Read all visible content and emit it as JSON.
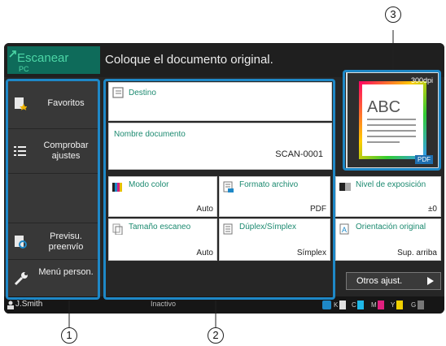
{
  "app": {
    "title": "Escanear",
    "subtitle": "PC"
  },
  "header": {
    "message": "Coloque el documento original."
  },
  "sidebar": {
    "items": [
      {
        "label": "Favoritos",
        "icon": "favorites-icon"
      },
      {
        "label": "Comprobar ajustes",
        "icon": "list-icon"
      },
      {
        "label": "Previsu. preenvío",
        "icon": "preview-icon"
      },
      {
        "label": "Menú person.",
        "icon": "wrench-icon"
      }
    ]
  },
  "fields": {
    "destino": {
      "label": "Destino",
      "value": ""
    },
    "nombre": {
      "label": "Nombre documento",
      "value": "SCAN-0001"
    }
  },
  "settings": [
    {
      "label": "Modo color",
      "value": "Auto"
    },
    {
      "label": "Formato archivo",
      "value": "PDF"
    },
    {
      "label": "Nivel de exposición",
      "value": "±0"
    },
    {
      "label": "Tamaño escaneo",
      "value": "Auto"
    },
    {
      "label": "Dúplex/Símplex",
      "value": "Símplex"
    },
    {
      "label": "Orientación original",
      "value": "Sup. arriba"
    }
  ],
  "preview": {
    "dpi": "300dpi",
    "sample_text": "ABC",
    "format": "PDF"
  },
  "buttons": {
    "otros": "Otros ajust."
  },
  "status": {
    "user": "J.Smith",
    "state": "Inactivo",
    "inks": [
      "K",
      "C",
      "M",
      "Y",
      "G"
    ]
  },
  "callouts": [
    "1",
    "2",
    "3"
  ],
  "colors": {
    "accent": "#1e88c7",
    "brand": "#0e6b5a",
    "label_green": "#1c8a70"
  }
}
